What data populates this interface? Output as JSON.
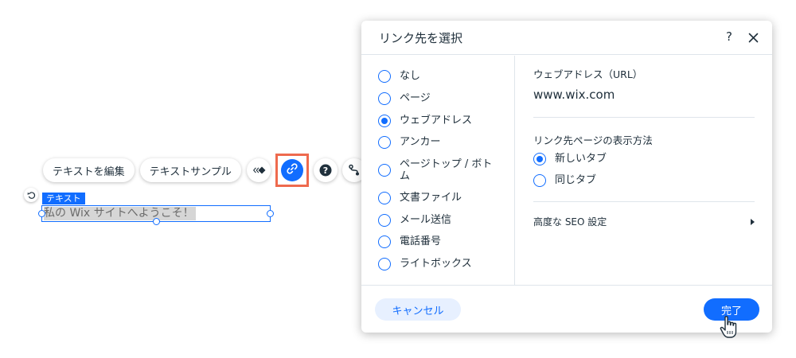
{
  "toolbar": {
    "edit_text_label": "テキストを編集",
    "text_samples_label": "テキストサンプル",
    "icons": [
      "animation-icon",
      "link-icon",
      "help-icon",
      "connect-icon"
    ]
  },
  "element": {
    "tag_label": "テキスト",
    "text": "私の Wix サイトへようこそ！"
  },
  "dialog": {
    "title": "リンク先を選択",
    "help": "?",
    "options": [
      {
        "label": "なし",
        "selected": false
      },
      {
        "label": "ページ",
        "selected": false
      },
      {
        "label": "ウェブアドレス",
        "selected": true
      },
      {
        "label": "アンカー",
        "selected": false
      },
      {
        "label": "ページトップ / ボトム",
        "selected": false
      },
      {
        "label": "文書ファイル",
        "selected": false
      },
      {
        "label": "メール送信",
        "selected": false
      },
      {
        "label": "電話番号",
        "selected": false
      },
      {
        "label": "ライトボックス",
        "selected": false
      }
    ],
    "url_label": "ウェブアドレス（URL）",
    "url_value": "www.wix.com",
    "open_mode_label": "リンク先ページの表示方法",
    "open_modes": [
      {
        "label": "新しいタブ",
        "selected": true
      },
      {
        "label": "同じタブ",
        "selected": false
      }
    ],
    "seo_label": "高度な SEO 設定",
    "cancel_label": "キャンセル",
    "done_label": "完了"
  },
  "colors": {
    "accent": "#116dff",
    "highlight": "#ee6a4e",
    "text": "#20303c"
  }
}
